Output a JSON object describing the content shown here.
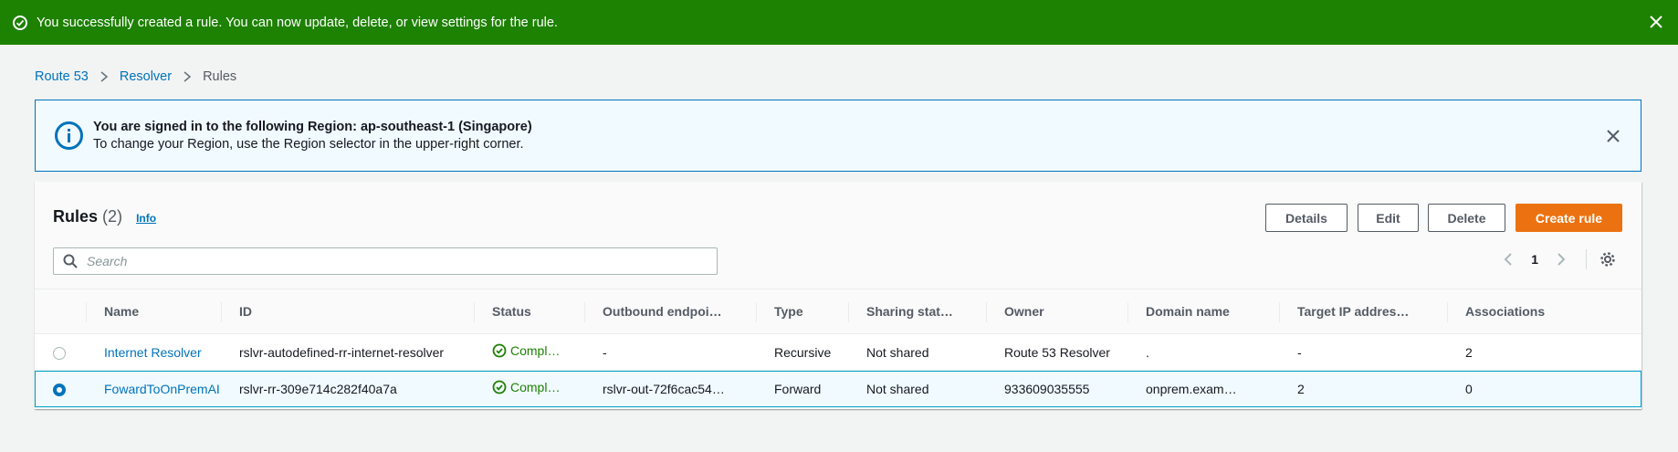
{
  "flash": {
    "message": "You successfully created a rule. You can now update, delete, or view settings for the rule.",
    "icon": "check-circle-icon",
    "color": "#1d8102"
  },
  "breadcrumb": [
    "Route 53",
    "Resolver",
    "Rules"
  ],
  "region_banner": {
    "title": "You are signed in to the following Region: ap-southeast-1 (Singapore)",
    "text": "To change your Region, use the Region selector in the upper-right corner."
  },
  "rules": {
    "title": "Rules",
    "count": "(2)",
    "info": "Info",
    "buttons": {
      "details": "Details",
      "edit": "Edit",
      "delete": "Delete",
      "create": "Create rule"
    },
    "search_placeholder": "Search",
    "page": "1",
    "columns": [
      "Name",
      "ID",
      "Status",
      "Outbound endpoi…",
      "Type",
      "Sharing stat…",
      "Owner",
      "Domain name",
      "Target IP addres…",
      "Associations"
    ],
    "rows": [
      {
        "name": "Internet Resolver",
        "id": "rslvr-autodefined-rr-internet-resolver",
        "status": "Compl…",
        "outbound": "-",
        "type": "Recursive",
        "sharing": "Not shared",
        "owner": "Route 53 Resolver",
        "domain": ".",
        "target": "-",
        "associations": "2",
        "selected": false
      },
      {
        "name": "FowardToOnPremAI",
        "id": "rslvr-rr-309e714c282f40a7a",
        "status": "Compl…",
        "outbound": "rslvr-out-72f6cac54…",
        "type": "Forward",
        "sharing": "Not shared",
        "owner": "933609035555",
        "domain": "onprem.exam…",
        "target": "2",
        "associations": "0",
        "selected": true
      }
    ]
  },
  "colors": {
    "primary_button": "#ec7211",
    "link": "#0073bb",
    "success": "#1d8102",
    "info_border": "#0073bb"
  }
}
